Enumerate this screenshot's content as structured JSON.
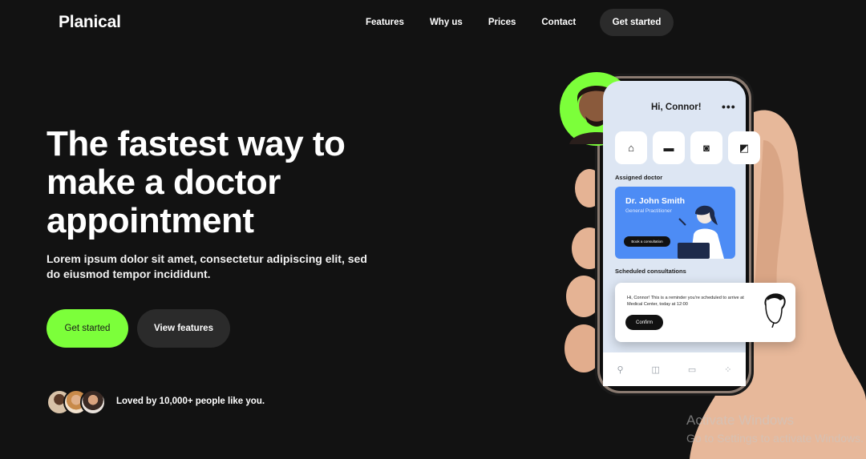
{
  "nav": {
    "logo": "Planical",
    "links": [
      "Features",
      "Why us",
      "Prices",
      "Contact"
    ],
    "cta": "Get started"
  },
  "hero": {
    "headline": "The fastest way to make a doctor appointment",
    "subtitle": "Lorem ipsum dolor sit amet, consectetur adipiscing elit, sed do eiusmod tempor incididunt.",
    "primary_button": "Get started",
    "secondary_button": "View features",
    "social_proof": "Loved by 10,000+ people like you."
  },
  "app": {
    "greeting": "Hi, Connor!",
    "menu": "•••",
    "assigned_label": "Assigned doctor",
    "doctor_name": "Dr. John Smith",
    "doctor_role": "General Practitioner",
    "doctor_button": "Book a consultation",
    "scheduled_label": "Scheduled consultations",
    "reminder": "Hi, Connor! This is a reminder you're scheduled to arrive at Medical Center, today at 12:00",
    "confirm": "Confirm",
    "tab_icons": [
      "person-icon",
      "chart-icon",
      "calendar-icon",
      "grid-icon"
    ],
    "tile_icons": [
      "home-icon",
      "card-icon",
      "camera-icon",
      "document-icon"
    ]
  },
  "os_watermark": {
    "line1": "Activate Windows",
    "line2": "Go to Settings to activate Windows."
  },
  "colors": {
    "background": "#121212",
    "accent_green": "#7cff3a",
    "card_blue": "#4d8cf5",
    "button_dark": "#2b2b2b"
  }
}
